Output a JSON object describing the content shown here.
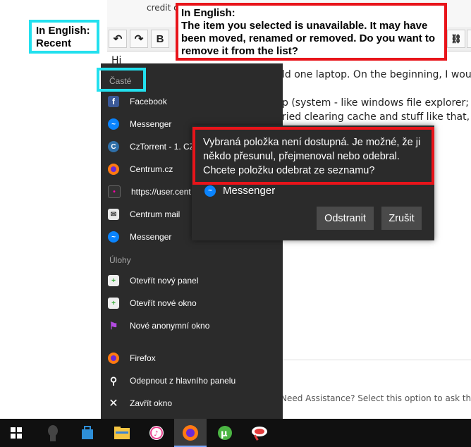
{
  "annotations": {
    "recent_label_line1": "In English:",
    "recent_label_line2": "Recent",
    "error_title": "In English:",
    "error_text": "The item you selected is unavailable. It may have been moved, renamed or removed. Do you want to remove it from the list?"
  },
  "background_page": {
    "credit_text": "credit c",
    "line1": "Hi",
    "line2": "ld one laptop. On the beginning, I would",
    "line3": "p (system - like windows file explorer; or",
    "line4": "ried clearing cache and stuff like that, run",
    "assistance_text": "Need Assistance? Select this option to ask the",
    "toolbar": {
      "undo_icon": "↶",
      "redo_icon": "↷",
      "bold_label": "B",
      "link_icon": "⛓"
    }
  },
  "jumplist": {
    "frequent_header": "Časté",
    "frequent_items": [
      {
        "label": "Facebook",
        "icon": "facebook-icon"
      },
      {
        "label": "Messenger",
        "icon": "messenger-icon"
      },
      {
        "label": "CzTorrent - 1. CZ",
        "icon": "cztorrent-icon"
      },
      {
        "label": "Centrum.cz",
        "icon": "firefox-icon"
      },
      {
        "label": "https://user.cent",
        "icon": "site-icon"
      },
      {
        "label": "Centrum mail",
        "icon": "mail-icon"
      },
      {
        "label": "Messenger",
        "icon": "messenger-icon"
      }
    ],
    "tasks_header": "Úlohy",
    "task_items": [
      {
        "label": "Otevřít nový panel",
        "icon": "new-tab-icon"
      },
      {
        "label": "Otevřít nové okno",
        "icon": "new-window-icon"
      },
      {
        "label": "Nové anonymní okno",
        "icon": "private-window-icon"
      }
    ],
    "app_items": [
      {
        "label": "Firefox",
        "icon": "firefox-icon"
      },
      {
        "label": "Odepnout z hlavního panelu",
        "icon": "unpin-icon"
      },
      {
        "label": "Zavřít okno",
        "icon": "close-icon"
      }
    ]
  },
  "dialog": {
    "message": "Vybraná položka není dostupná. Je možné, že ji někdo přesunul, přejmenoval nebo odebral. Chcete položku odebrat ze seznamu?",
    "item_label": "Messenger",
    "remove_button": "Odstranit",
    "cancel_button": "Zrušit"
  },
  "taskbar": {
    "items": [
      "start-icon",
      "cortana-icon",
      "store-icon",
      "file-explorer-icon",
      "itunes-icon",
      "firefox-icon",
      "utorrent-icon",
      "app-icon"
    ],
    "active_index": 5
  },
  "colors": {
    "annotation_cyan": "#22e0ee",
    "annotation_red": "#e8141a",
    "menu_bg": "#2b2b2b",
    "taskbar_bg": "#101010"
  }
}
